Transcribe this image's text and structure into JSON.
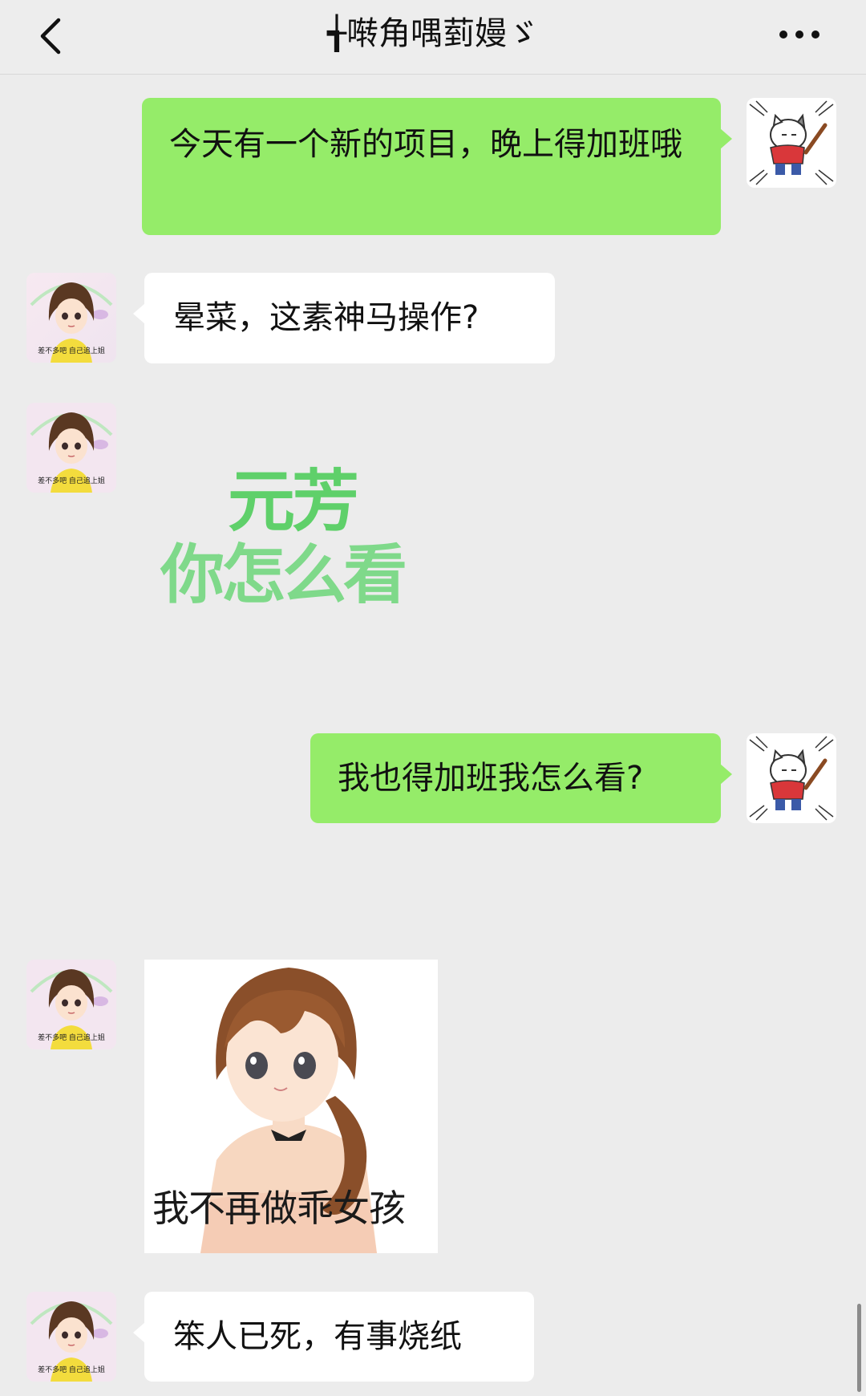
{
  "header": {
    "title": "╅啭角喁菿嫚ゞ",
    "back_icon": "chevron-left-icon",
    "more_icon": "more-dots-icon"
  },
  "colors": {
    "my_bubble": "#95ec69",
    "their_bubble": "#ffffff",
    "background": "#ececec",
    "sticker_green": "#5fd06a"
  },
  "avatar_caption": "差不多吧 自己追上姐",
  "messages": [
    {
      "sender": "me",
      "type": "text",
      "text": "今天有一个新的项目，晚上得加班哦"
    },
    {
      "sender": "them",
      "type": "text",
      "text": "晕菜，这素神马操作?"
    },
    {
      "sender": "them",
      "type": "sticker",
      "line1": "元芳",
      "line2": "你怎么看"
    },
    {
      "sender": "me",
      "type": "text",
      "text": "我也得加班我怎么看?"
    },
    {
      "sender": "them",
      "type": "sticker",
      "caption": "我不再做乖女孩"
    },
    {
      "sender": "them",
      "type": "text",
      "text": "笨人已死，有事烧纸"
    }
  ]
}
